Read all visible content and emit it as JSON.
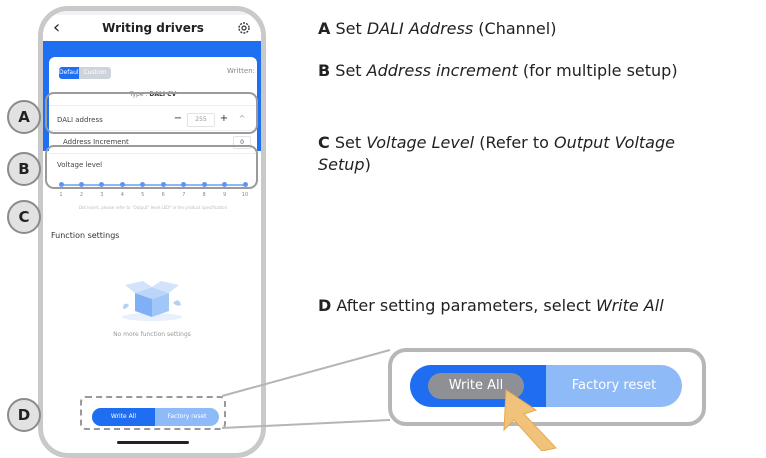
{
  "app": {
    "title": "Writing drivers",
    "back_icon": "chevron-left-icon",
    "settings_icon": "gear-icon"
  },
  "card": {
    "tab_default": "Default",
    "tab_other": "Custom",
    "written_label": "Written:",
    "type_prefix": "Type : ",
    "type_value": "DALI CV",
    "dali_address_label": "DALI address",
    "dali_minus": "−",
    "dali_address_value": "255",
    "dali_plus": "+",
    "address_increment_label": "Address Increment",
    "address_increment_value": "0",
    "voltage_level_label": "Voltage level",
    "voltage_ticks": [
      "1",
      "2",
      "3",
      "4",
      "5",
      "6",
      "7",
      "8",
      "9",
      "10"
    ],
    "slider_hint": "Dot Insert, please refer to \"Output\" level LED* in the product specification"
  },
  "function_settings": {
    "title": "Function settings",
    "empty_text": "No more function settings"
  },
  "bottom_bar": {
    "write_all": "Write All",
    "factory_reset": "Factory reset"
  },
  "callouts": {
    "a": "A",
    "b": "B",
    "c": "C",
    "d": "D"
  },
  "instructions": {
    "a_letter": "A",
    "a_pre": " Set ",
    "a_em": "DALI Address",
    "a_post": " (Channel)",
    "b_letter": "B",
    "b_pre": " Set ",
    "b_em": "Address increment",
    "b_post": " (for multiple setup)",
    "c_letter": "C",
    "c_pre": " Set ",
    "c_em": "Voltage Level",
    "c_mid": " (Refer to ",
    "c_em2": "Output Voltage Setup",
    "c_post": ")",
    "d_letter": "D",
    "d_pre": " After setting parameters, select ",
    "d_em": "Write All"
  },
  "zoom": {
    "write_all": "Write All",
    "factory_reset": "Factory reset"
  },
  "colors": {
    "accent": "#1e6ff2",
    "accent_light": "#8fbaf8",
    "arrow": "#f1c27a"
  }
}
